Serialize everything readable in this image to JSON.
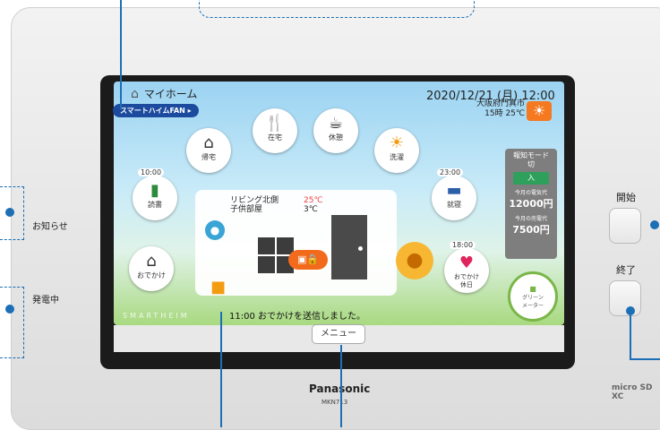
{
  "home": {
    "title": "マイホーム",
    "fan_badge": "スマートハイムFAN ▸"
  },
  "datetime": "2020/12/21 (月) 12:00",
  "location": {
    "city": "大阪府門真市",
    "forecast": "15時 25℃"
  },
  "actions": [
    {
      "label": "在宅",
      "icon": "dining-icon"
    },
    {
      "label": "休憩",
      "icon": "coffee-icon"
    },
    {
      "label": "帰宅",
      "icon": "home-person-icon"
    },
    {
      "label": "洗濯",
      "icon": "sun-icon"
    },
    {
      "label": "読書",
      "icon": "book-icon",
      "time": "10:00"
    },
    {
      "label": "就寝",
      "icon": "bed-icon",
      "time": "23:00"
    },
    {
      "label": "おでかけ",
      "icon": "outing-icon"
    },
    {
      "label": "おでかけ\n休日",
      "icon": "heart-icon",
      "time": "18:00"
    }
  ],
  "status": {
    "rooms": "リビング北側\n子供部屋",
    "temps": [
      "25℃",
      "3℃"
    ]
  },
  "right_panel": {
    "mode_title": "報知モード\n切",
    "mode_button": "入",
    "electric_label": "今月の電気代",
    "electric_value": "12000円",
    "sale_label": "今月の売電代",
    "sale_value": "7500円"
  },
  "meter": {
    "label": "グリーン\nメーター"
  },
  "notification": "11:00 おでかけを送信しました。",
  "watermark": "SMARTHEIM",
  "menu_label": "メニュー",
  "hardware": {
    "start_label": "開始",
    "end_label": "終了",
    "brand": "Panasonic",
    "model": "MKN713",
    "sd": "micro SD XC"
  },
  "annotations": {
    "notice": "お知らせ",
    "generating": "発電中"
  }
}
